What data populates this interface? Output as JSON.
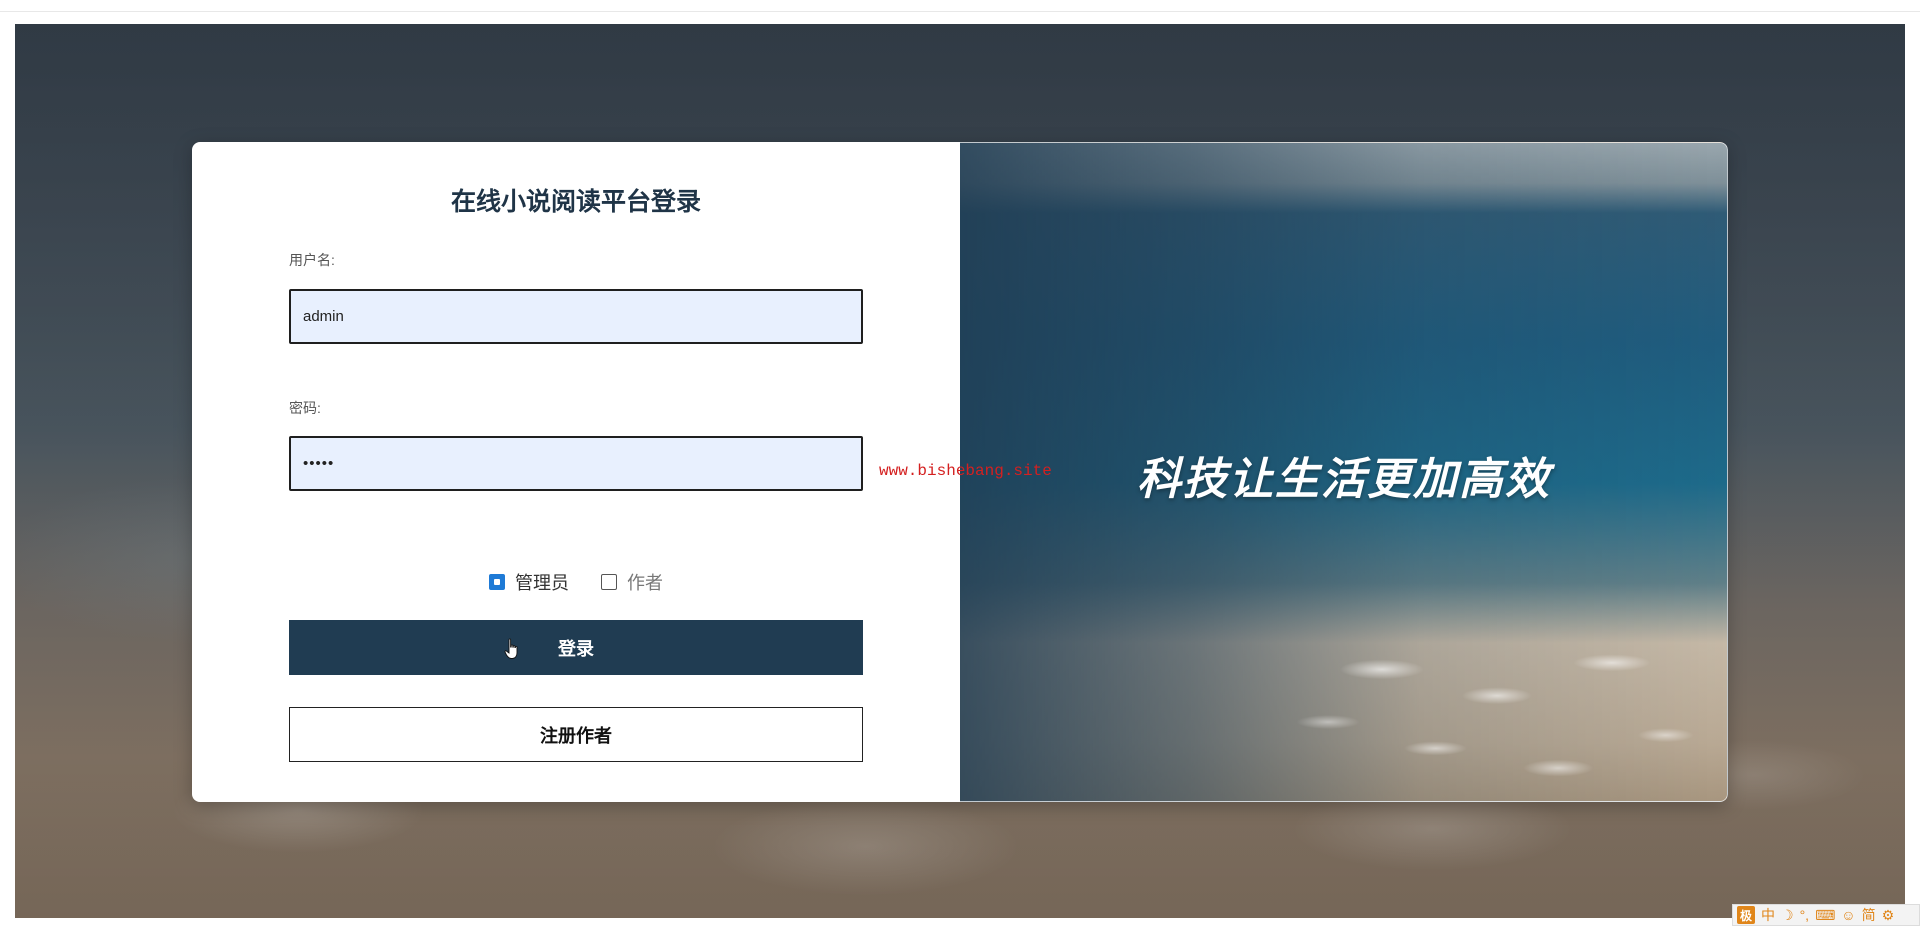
{
  "login_form": {
    "title": "在线小说阅读平台登录",
    "username_label": "用户名:",
    "username_value": "admin",
    "password_label": "密码:",
    "password_value": "•••••",
    "roles": [
      {
        "label": "管理员",
        "checked": true
      },
      {
        "label": "作者",
        "checked": false
      }
    ],
    "login_button": "登录",
    "register_button": "注册作者"
  },
  "banner": {
    "slogan": "科技让生活更加高效"
  },
  "watermark": "www.bishebang.site",
  "ime_toolbar": {
    "logo": "极",
    "items": [
      "中",
      "☽",
      "°,",
      "⌨",
      "☺",
      "简",
      "⚙"
    ]
  },
  "colors": {
    "primary": "#203c52",
    "title": "#1f3447",
    "input_bg": "#e8f0fe",
    "checkbox_checked": "#1e7ad6",
    "watermark": "#d42020",
    "ime_accent": "#e0861a"
  }
}
